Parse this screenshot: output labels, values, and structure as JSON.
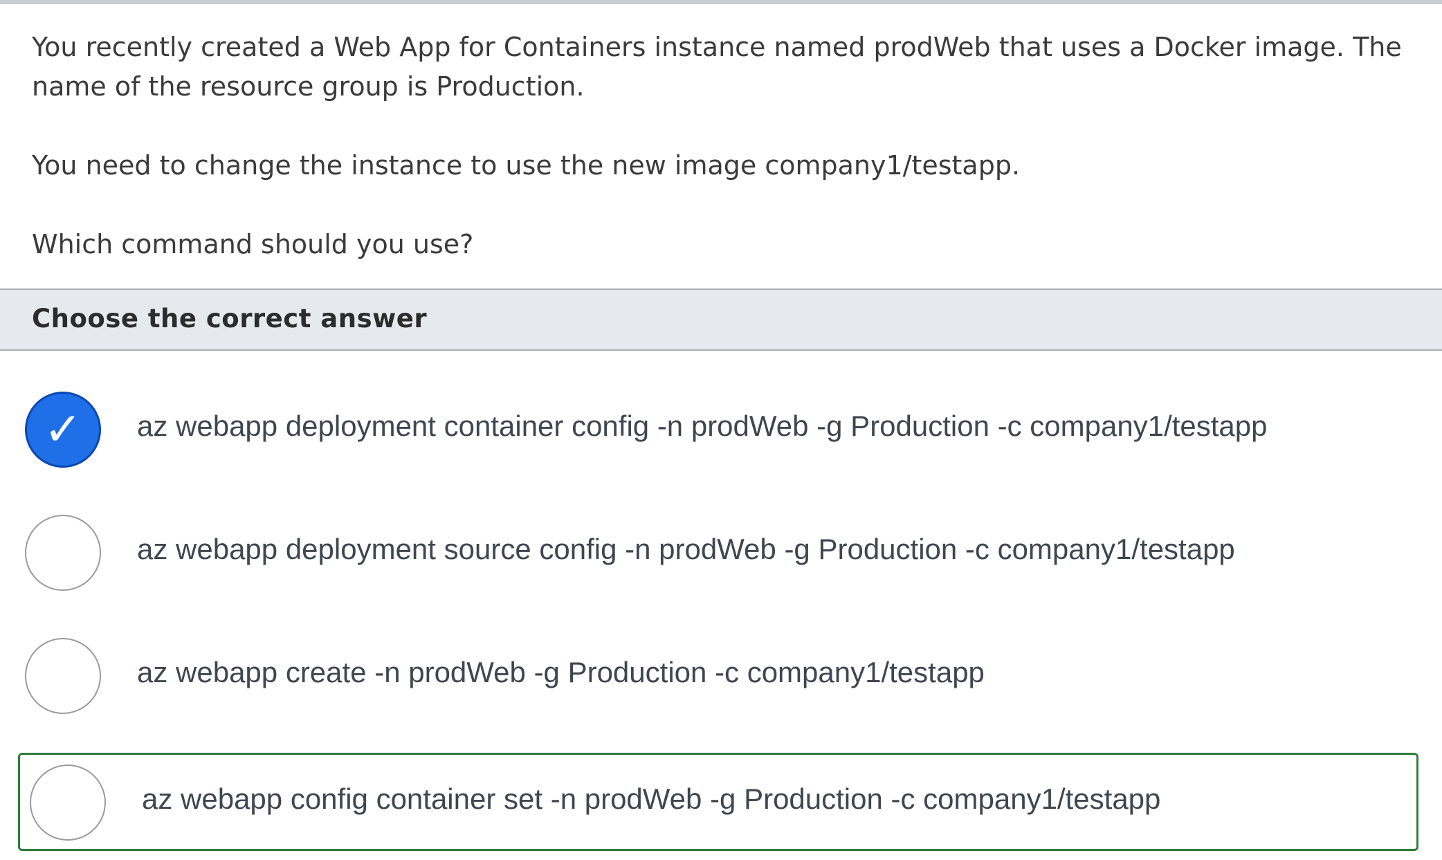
{
  "question": {
    "paragraphs": [
      "You recently created a Web App for Containers instance named prodWeb that uses a Docker image. The name of the resource group is Production.",
      "You need to change the instance to use the new image company1/testapp.",
      "Which command should you use?"
    ]
  },
  "prompt": {
    "label": "Choose the correct answer"
  },
  "options": [
    {
      "label": "az webapp deployment container config -n prodWeb -g Production -c company1/testapp",
      "selected": true,
      "check_glyph": "✓",
      "highlighted_correct": false
    },
    {
      "label": "az webapp deployment source config -n prodWeb -g Production -c company1/testapp",
      "selected": false,
      "highlighted_correct": false
    },
    {
      "label": "az webapp create -n prodWeb -g Production -c company1/testapp",
      "selected": false,
      "highlighted_correct": false
    },
    {
      "label": "az webapp config container set -n prodWeb -g Production -c company1/testapp",
      "selected": false,
      "highlighted_correct": true
    }
  ],
  "colors": {
    "selected_radio": "#1f6fe8",
    "correct_border": "#2e7d3a",
    "prompt_bar_bg": "#e6e9ed"
  }
}
